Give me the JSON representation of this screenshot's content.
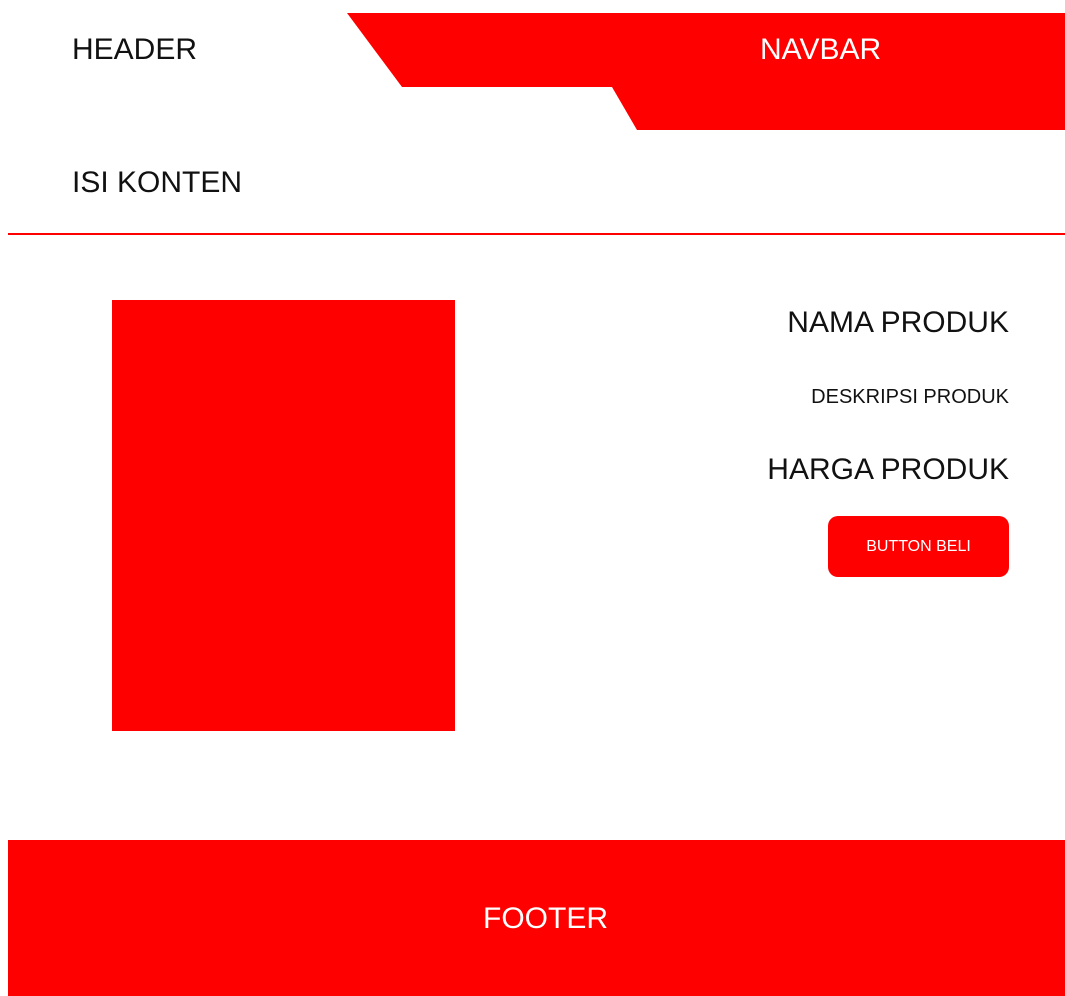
{
  "colors": {
    "accent": "#ff0000",
    "background": "#ffffff",
    "text": "#111111",
    "text_on_accent": "#ffffff"
  },
  "header": {
    "label": "HEADER"
  },
  "navbar": {
    "label": "NAVBAR"
  },
  "content": {
    "title": "ISI KONTEN"
  },
  "product": {
    "name": "NAMA PRODUK",
    "description": "DESKRIPSI PRODUK",
    "price": "HARGA PRODUK",
    "buy_label": "BUTTON BELI"
  },
  "footer": {
    "label": "FOOTER"
  }
}
